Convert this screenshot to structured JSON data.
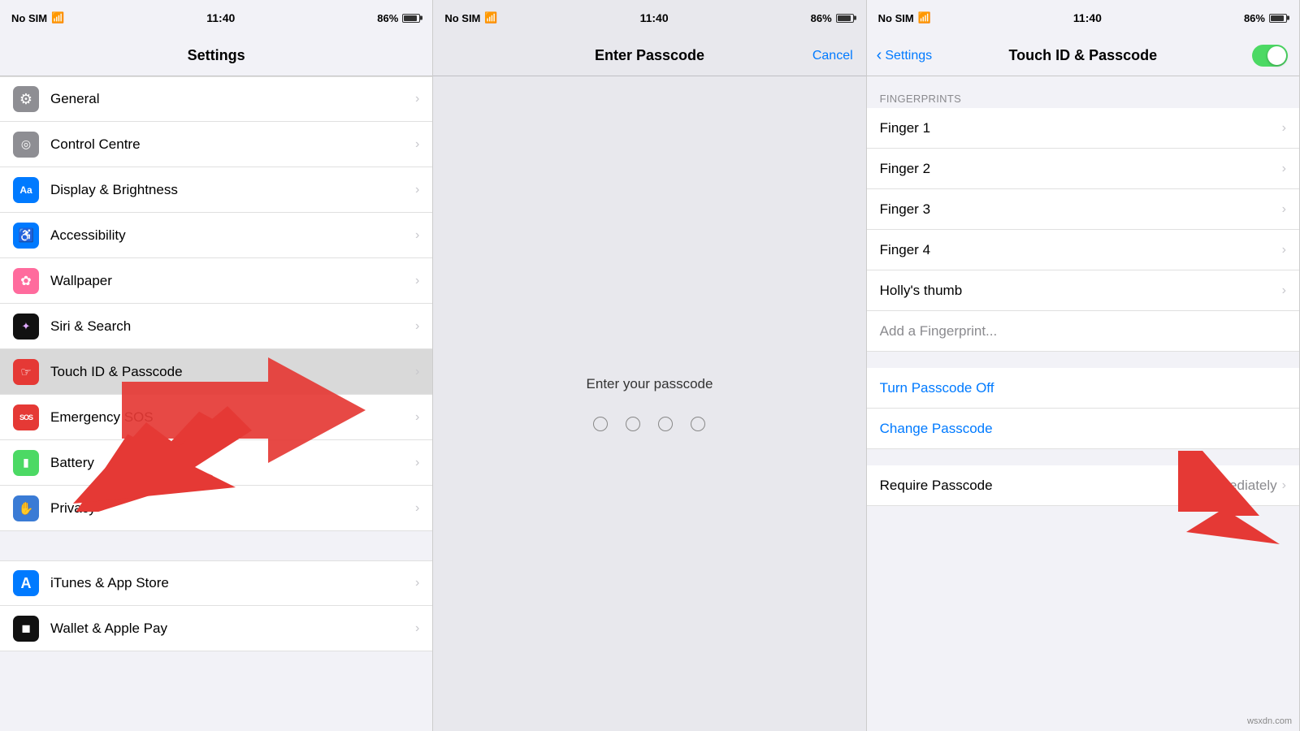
{
  "statusBar": {
    "carrier": "No SIM",
    "wifi": "📶",
    "time": "11:40",
    "battery_pct": "86%"
  },
  "panel1": {
    "title": "Settings",
    "items": [
      {
        "id": "general",
        "label": "General",
        "iconBg": "#8e8e93",
        "iconChar": "⚙",
        "iconColor": "#fff"
      },
      {
        "id": "control-centre",
        "label": "Control Centre",
        "iconBg": "#8e8e93",
        "iconChar": "◎",
        "iconColor": "#fff"
      },
      {
        "id": "display",
        "label": "Display & Brightness",
        "iconBg": "#007aff",
        "iconChar": "Aa",
        "iconColor": "#fff"
      },
      {
        "id": "accessibility",
        "label": "Accessibility",
        "iconBg": "#007aff",
        "iconChar": "♿",
        "iconColor": "#fff"
      },
      {
        "id": "wallpaper",
        "label": "Wallpaper",
        "iconBg": "#ff6b9d",
        "iconChar": "✿",
        "iconColor": "#fff"
      },
      {
        "id": "siri",
        "label": "Siri & Search",
        "iconBg": "#222",
        "iconChar": "✦",
        "iconColor": "#e0aaff"
      },
      {
        "id": "touchid",
        "label": "Touch ID & Passcode",
        "iconBg": "#e53935",
        "iconChar": "☞",
        "iconColor": "#fff",
        "highlighted": true
      },
      {
        "id": "emergency",
        "label": "Emergency SOS",
        "iconBg": "#e53935",
        "iconChar": "SOS",
        "iconColor": "#fff"
      },
      {
        "id": "battery",
        "label": "Battery",
        "iconBg": "#4cd964",
        "iconChar": "▮",
        "iconColor": "#fff"
      },
      {
        "id": "privacy",
        "label": "Privacy",
        "iconBg": "#3a7bd5",
        "iconChar": "✋",
        "iconColor": "#fff"
      }
    ],
    "section2": [
      {
        "id": "itunes",
        "label": "iTunes & App Store",
        "iconBg": "#007aff",
        "iconChar": "A",
        "iconColor": "#fff"
      },
      {
        "id": "wallet",
        "label": "Wallet & Apple Pay",
        "iconBg": "#222",
        "iconChar": "◼",
        "iconColor": "#fff"
      }
    ]
  },
  "panel2": {
    "title": "Enter Passcode",
    "cancel": "Cancel",
    "prompt": "Enter your passcode",
    "dots": [
      "",
      "",
      "",
      ""
    ]
  },
  "panel3": {
    "backLabel": "Settings",
    "title": "Touch ID & Passcode",
    "fingerprintsHeader": "FINGERPRINTS",
    "fingers": [
      {
        "id": "finger1",
        "label": "Finger 1"
      },
      {
        "id": "finger2",
        "label": "Finger 2"
      },
      {
        "id": "finger3",
        "label": "Finger 3"
      },
      {
        "id": "finger4",
        "label": "Finger 4"
      },
      {
        "id": "hollys-thumb",
        "label": "Holly's thumb"
      }
    ],
    "addFingerprint": "Add a Fingerprint...",
    "turnPasscodeOff": "Turn Passcode Off",
    "changePasscode": "Change Passcode",
    "requirePasscodeLabel": "Require Passcode",
    "requirePasscodeValue": "Immediately"
  },
  "watermark": "wsxdn.com"
}
